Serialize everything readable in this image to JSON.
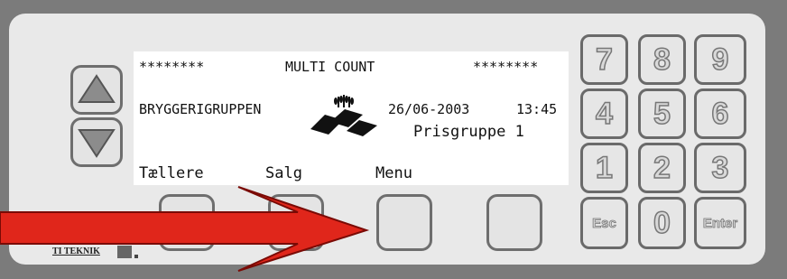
{
  "display": {
    "stars_left": "********",
    "title": "MULTI COUNT",
    "stars_right": "********",
    "company": "BRYGGERIGRUPPEN",
    "date": "26/06-2003",
    "time": "13:45",
    "price_group": "Prisgruppe 1",
    "softkey_1": "Tællere",
    "softkey_2": "Salg",
    "softkey_3": "Menu"
  },
  "keypad": {
    "k7": "7",
    "k8": "8",
    "k9": "9",
    "k4": "4",
    "k5": "5",
    "k6": "6",
    "k1": "1",
    "k2": "2",
    "k3": "3",
    "esc": "Esc",
    "k0": "0",
    "enter": "Enter"
  },
  "brand": {
    "logo_text": "TI TEKNIK"
  },
  "colors": {
    "arrow": "#e0261b",
    "casing": "#7b7b7b",
    "panel": "#e9e9e9",
    "button_border": "#6e6e6e"
  }
}
